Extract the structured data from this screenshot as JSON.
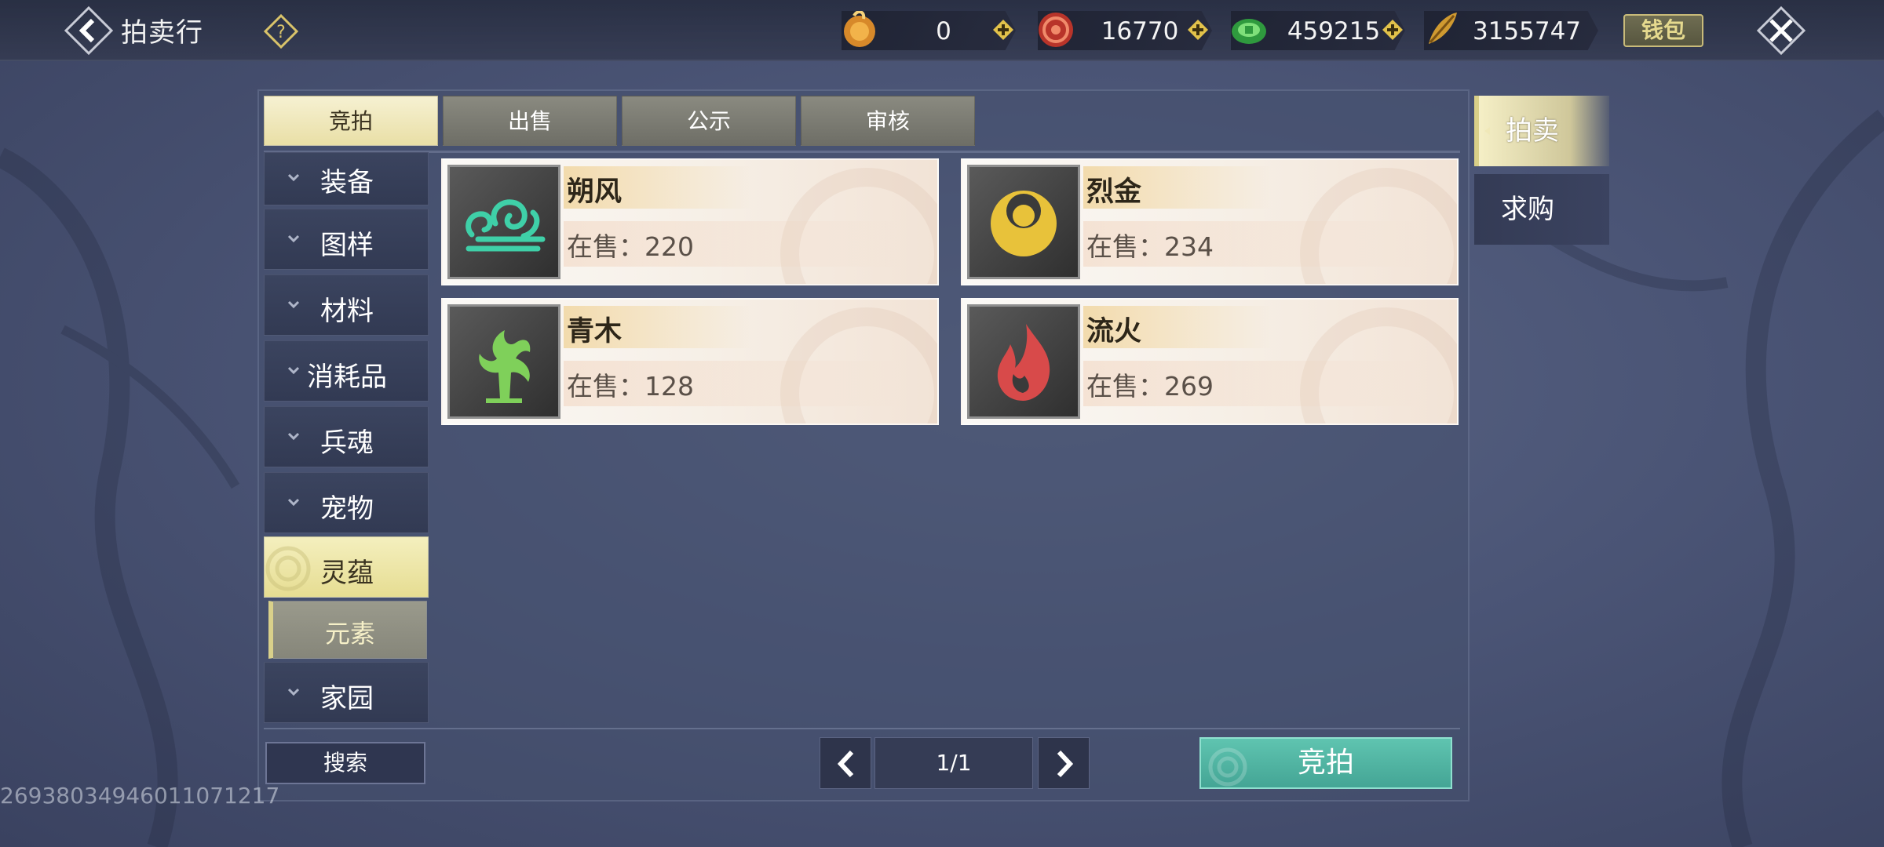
{
  "header": {
    "title": "拍卖行",
    "wallet_label": "钱包"
  },
  "currencies": [
    {
      "icon": "gold-ingot-icon",
      "value": "0",
      "color": "#e8a13a"
    },
    {
      "icon": "red-token-icon",
      "value": "16770",
      "color": "#d84a3a"
    },
    {
      "icon": "jade-coin-icon",
      "value": "459215",
      "color": "#3fb04a"
    },
    {
      "icon": "gold-feather-icon",
      "value": "3155747",
      "color": "#d8a23a"
    }
  ],
  "tabs": [
    {
      "label": "竞拍",
      "active": true
    },
    {
      "label": "出售",
      "active": false
    },
    {
      "label": "公示",
      "active": false
    },
    {
      "label": "审核",
      "active": false
    }
  ],
  "categories": [
    {
      "label": "装备",
      "expandable": true
    },
    {
      "label": "图样",
      "expandable": true
    },
    {
      "label": "材料",
      "expandable": true
    },
    {
      "label": "消耗品",
      "expandable": true
    },
    {
      "label": "兵魂",
      "expandable": true
    },
    {
      "label": "宠物",
      "expandable": true
    },
    {
      "label": "灵蕴",
      "expandable": false,
      "active": true
    },
    {
      "label": "元素",
      "sub": true
    },
    {
      "label": "家园",
      "expandable": true
    }
  ],
  "items": [
    {
      "name": "朔风",
      "count": "在售：220",
      "icon": "wind-icon",
      "color": "#3fd0a8"
    },
    {
      "name": "烈金",
      "count": "在售：234",
      "icon": "gold-moon-icon",
      "color": "#e8c23a"
    },
    {
      "name": "青木",
      "count": "在售：128",
      "icon": "tree-icon",
      "color": "#7fd05a"
    },
    {
      "name": "流火",
      "count": "在售：269",
      "icon": "flame-icon",
      "color": "#d84a4a"
    }
  ],
  "bottom": {
    "search_label": "搜索",
    "page": "1/1",
    "bid_label": "竞拍"
  },
  "side_tabs": [
    {
      "label": "拍卖",
      "active": true
    },
    {
      "label": "求购",
      "active": false
    }
  ],
  "uid": "2693803494601107121​7"
}
